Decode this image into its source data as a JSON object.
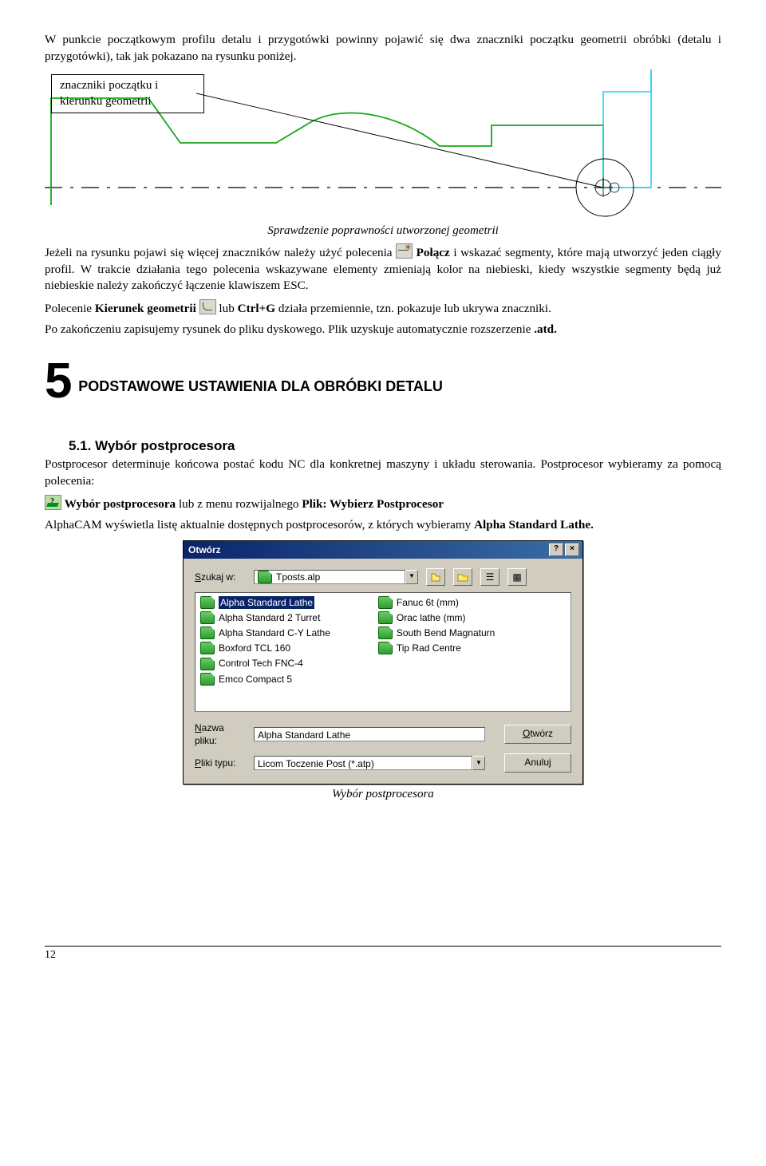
{
  "p1": "W punkcie początkowym profilu detalu i przygotówki powinny pojawić się dwa znaczniki początku geometrii obróbki (detalu i przygotówki), tak jak pokazano na rysunku poniżej.",
  "box": "znaczniki początku i kierunku geometrii",
  "caption1": "Sprawdzenie poprawności utworzonej geometrii",
  "p2a": "Jeżeli na rysunku pojawi się więcej znaczników należy użyć polecenia ",
  "p2b": " Połącz",
  "p2c": " i wskazać segmenty, które mają utworzyć jeden ciągły profil. W trakcie działania tego polecenia wskazywane elementy zmieniają kolor na niebieski, kiedy wszystkie segmenty będą już niebieskie należy zakończyć łączenie klawiszem ESC.",
  "p3a": "Polecenie ",
  "p3b": "Kierunek geometrii",
  "p3c": " lub ",
  "p3d": "Ctrl+G",
  "p3e": " działa przemiennie, tzn. pokazuje lub ukrywa znaczniki.",
  "p4a": "Po zakończeniu zapisujemy rysunek do pliku dyskowego. Plik uzyskuje automatycznie rozszerzenie",
  "p4b": ".atd.",
  "chapN": "5",
  "chapTitle": "PODSTAWOWE USTAWIENIA DLA OBRÓBKI DETALU",
  "sub51": "5.1. Wybór postprocesora",
  "p5": "Postprocesor determinuje końcowa postać kodu NC dla konkretnej maszyny i układu sterowania. Postprocesor wybieramy za pomocą polecenia:",
  "p6a": " Wybór postprocesora",
  "p6b": " lub z menu rozwijalnego ",
  "p6c": "Plik: Wybierz Postprocesor",
  "p7a": "AlphaCAM wyświetla listę aktualnie dostępnych postprocesorów, z których wybieramy ",
  "p7b": "Alpha Standard Lathe.",
  "dlg": {
    "title": "Otwórz",
    "help": "?",
    "close": "×",
    "searchLab": "Szukaj w:",
    "searchVal": "Tposts.alp",
    "col1": [
      "Alpha Standard  Lathe",
      "Alpha Standard 2 Turret",
      "Alpha Standard C-Y Lathe",
      "Boxford TCL 160",
      "Control Tech FNC-4",
      "Emco Compact 5"
    ],
    "col2": [
      "Fanuc 6t (mm)",
      "Orac lathe (mm)",
      "South Bend Magnaturn",
      "Tip Rad Centre"
    ],
    "nameLab": "Nazwa pliku:",
    "nameVal": "Alpha Standard  Lathe",
    "typeLab": "Pliki typu:",
    "typeVal": "Licom Toczenie Post (*.atp)",
    "open": "Otwórz",
    "cancel": "Anuluj"
  },
  "caption2": "Wybór postprocesora",
  "pageno": "12"
}
